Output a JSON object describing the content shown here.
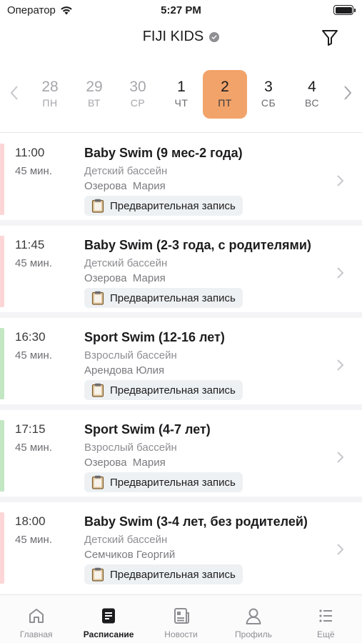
{
  "status_bar": {
    "carrier": "Оператор",
    "time": "5:27 PM"
  },
  "header": {
    "title": "FIJI KIDS"
  },
  "date_strip": {
    "days": [
      {
        "num": "28",
        "dow": "ПН",
        "state": "past"
      },
      {
        "num": "29",
        "dow": "ВТ",
        "state": "past"
      },
      {
        "num": "30",
        "dow": "СР",
        "state": "past"
      },
      {
        "num": "1",
        "dow": "ЧТ",
        "state": "future"
      },
      {
        "num": "2",
        "dow": "ПТ",
        "state": "selected"
      },
      {
        "num": "3",
        "dow": "СБ",
        "state": "future"
      },
      {
        "num": "4",
        "dow": "ВС",
        "state": "future"
      }
    ]
  },
  "colors": {
    "selected_day": "#f2a36a",
    "accent_red": "#fcd6d6",
    "accent_green": "#c3e6c3"
  },
  "lessons": [
    {
      "time": "11:00",
      "duration": "45 мин.",
      "title": "Baby Swim (9 мес-2 года)",
      "place": "Детский бассейн",
      "coach": "Озерова  Мария",
      "badge": "Предварительная запись",
      "accent": "red"
    },
    {
      "time": "11:45",
      "duration": "45 мин.",
      "title": "Baby Swim (2-3 года, с родителями)",
      "place": "Детский бассейн",
      "coach": "Озерова  Мария",
      "badge": "Предварительная запись",
      "accent": "red"
    },
    {
      "time": "16:30",
      "duration": "45 мин.",
      "title": "Sport Swim (12-16 лет)",
      "place": "Взрослый бассейн",
      "coach": "Арендова Юлия",
      "badge": "Предварительная запись",
      "accent": "green"
    },
    {
      "time": "17:15",
      "duration": "45 мин.",
      "title": "Sport Swim (4-7 лет)",
      "place": "Взрослый бассейн",
      "coach": "Озерова  Мария",
      "badge": "Предварительная запись",
      "accent": "green"
    },
    {
      "time": "18:00",
      "duration": "45 мин.",
      "title": "Baby Swim (3-4 лет, без родителей)",
      "place": "Детский бассейн",
      "coach": "Семчиков Георгий",
      "badge": "Предварительная запись",
      "accent": "red"
    }
  ],
  "tab_bar": {
    "tabs": [
      {
        "label": "Главная",
        "icon": "home-icon"
      },
      {
        "label": "Расписание",
        "icon": "schedule-icon",
        "active": true
      },
      {
        "label": "Новости",
        "icon": "news-icon"
      },
      {
        "label": "Профиль",
        "icon": "profile-icon"
      },
      {
        "label": "Ещё",
        "icon": "more-icon"
      }
    ]
  }
}
